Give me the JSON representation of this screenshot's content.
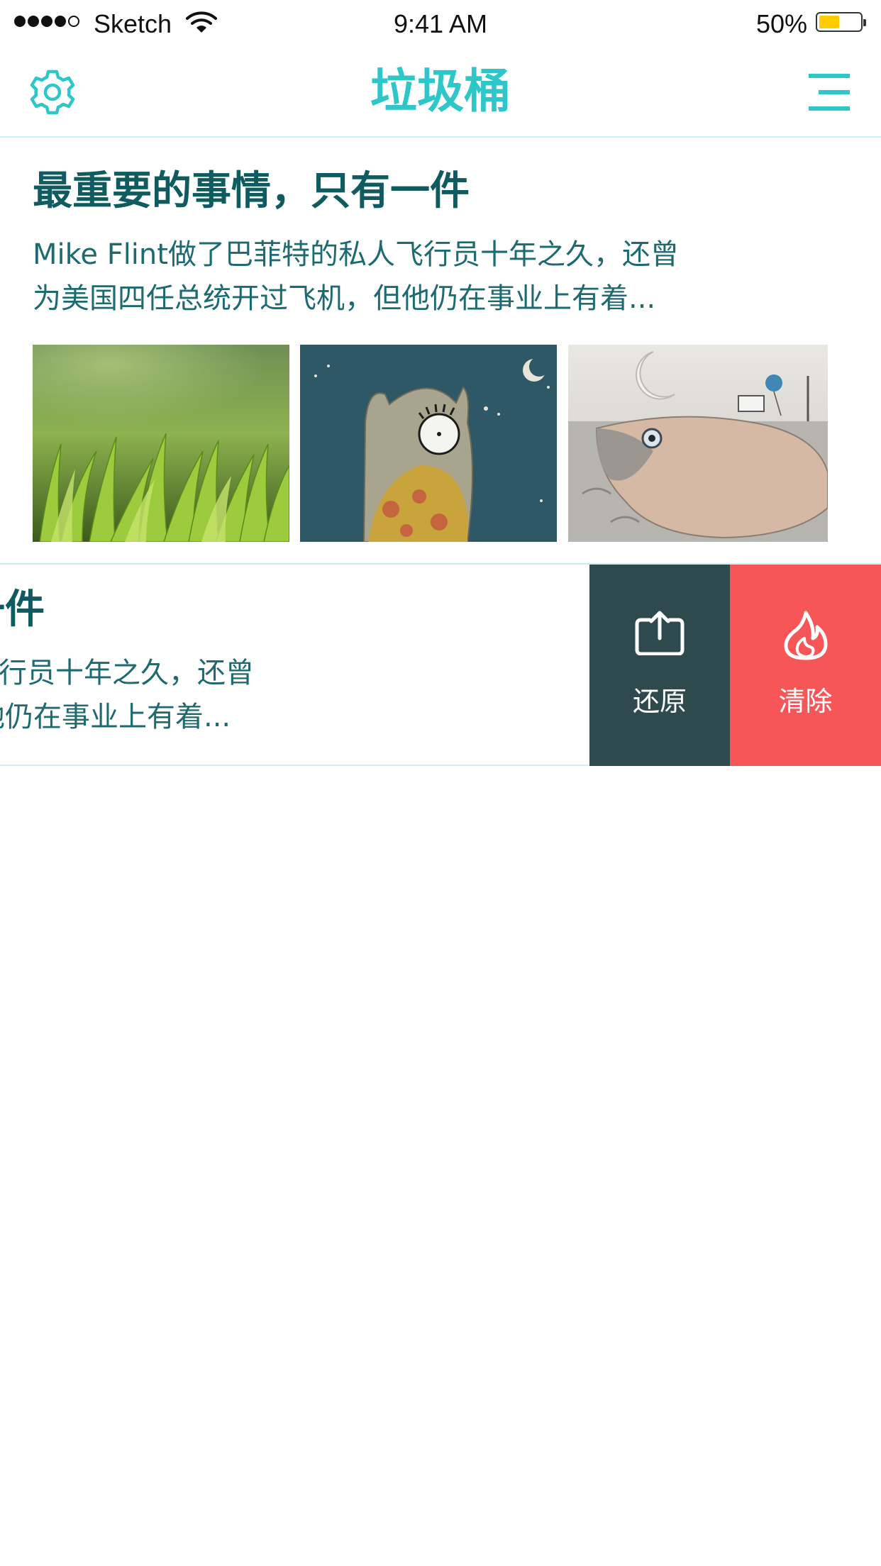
{
  "status_bar": {
    "carrier": "Sketch",
    "time": "9:41 AM",
    "battery_percent": "50%",
    "battery_level": 0.5,
    "battery_color": "#ffcc00",
    "signal_bars_filled": 4,
    "signal_bars_total": 5
  },
  "nav": {
    "title": "垃圾桶",
    "left_icon": "gear-icon",
    "right_icon": "menu-icon",
    "accent_color": "#2ec7c9"
  },
  "articles": [
    {
      "title": "最重要的事情，只有一件",
      "desc_line_1": "Mike Flint做了巴菲特的私人飞行员十年之久，还曾",
      "desc_line_2": "为美国四任总统开过飞机，但他仍在事业上有着...",
      "thumbnails": [
        "grass-photo",
        "owl-illustration",
        "fish-illustration"
      ]
    },
    {
      "title": "最重要的事情，只有一件",
      "desc_line_1": "Mike Flint做了巴菲特的私人飞行员十年之久，还曾",
      "desc_line_2": "为美国四任总统开过飞机，但他仍在事业上有着...",
      "swiped": true
    }
  ],
  "swipe_actions": {
    "restore": {
      "label": "还原",
      "icon": "share-up-icon",
      "color": "#2e4a4c"
    },
    "clear": {
      "label": "清除",
      "icon": "flame-icon",
      "color": "#f65658"
    }
  },
  "colors": {
    "title_text": "#0f5b5f",
    "body_text": "#1d6a70",
    "divider": "#cdeff1"
  }
}
